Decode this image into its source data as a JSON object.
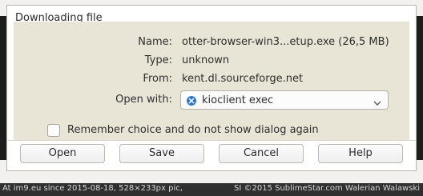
{
  "dialog": {
    "title": "Downloading file",
    "rows": {
      "name_label": "Name:",
      "name_value": "otter-browser-win3...etup.exe (26,5 MB)",
      "type_label": "Type:",
      "type_value": "unknown",
      "from_label": "From:",
      "from_value": "kent.dl.sourceforge.net",
      "openwith_label": "Open with:"
    },
    "open_with": {
      "selected": "kioclient exec",
      "icon": "kde-app-icon"
    },
    "checkbox": {
      "label": "Remember choice and do not show dialog again",
      "checked": false
    },
    "buttons": {
      "open": "Open",
      "save": "Save",
      "cancel": "Cancel",
      "help": "Help"
    }
  },
  "footer": {
    "left": "At im9.eu since 2015-08-18, 528×233px pic,",
    "right": "SI ©2015 SublimeStar.com Walerian Walawski"
  },
  "colors": {
    "content_bg": "#e8e4d6",
    "dialog_bg": "#ffffff",
    "footer_bg": "#2f2f2f",
    "accent_icon": "#2f78c5"
  }
}
